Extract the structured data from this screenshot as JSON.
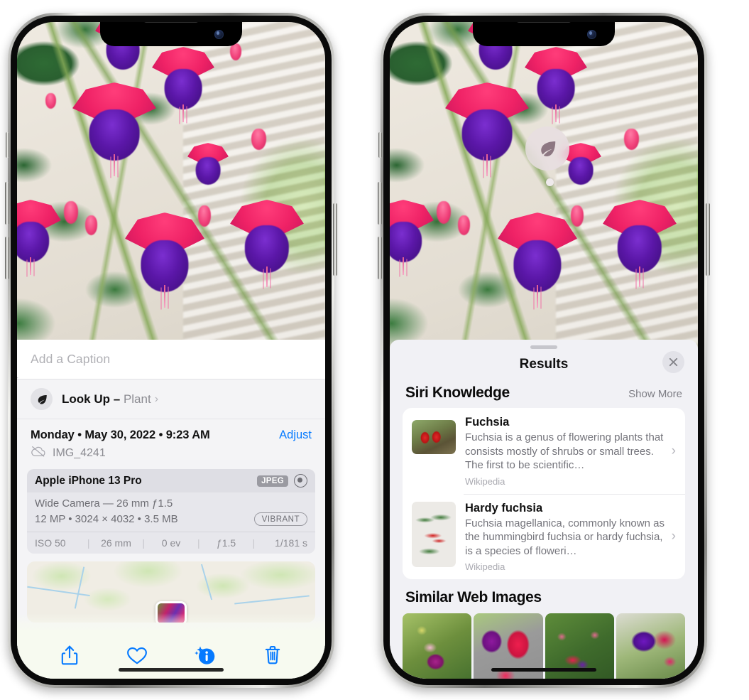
{
  "left_phone": {
    "name": "iphone-photos-info",
    "caption": {
      "placeholder": "Add a Caption",
      "value": ""
    },
    "lookup": {
      "icon": "leaf-icon",
      "sparkle_icon": "sparkle-icon",
      "label": "Look Up",
      "dash": "–",
      "subject": "Plant",
      "chevron": "›"
    },
    "meta": {
      "date": "Monday • May 30, 2022 • 9:23 AM",
      "adjust_label": "Adjust",
      "cloud_icon": "cloud-slash-icon",
      "filename": "IMG_4241"
    },
    "exif": {
      "device": "Apple iPhone 13 Pro",
      "format_tag": "JPEG",
      "aperture_icon": "aperture-icon",
      "lens": "Wide Camera — 26 mm ƒ1.5",
      "specs": "12 MP • 3024 × 4032 • 3.5 MB",
      "style_tag": "VIBRANT",
      "stats": [
        "ISO 50",
        "26 mm",
        "0 ev",
        "ƒ1.5",
        "1/181 s"
      ]
    },
    "map": {
      "name": "location-map",
      "pin": "photo-thumbnail-pin"
    },
    "toolbar": [
      {
        "name": "share-button",
        "icon": "share-icon"
      },
      {
        "name": "favorite-button",
        "icon": "heart-icon"
      },
      {
        "name": "info-button",
        "icon": "info-sparkle-icon"
      },
      {
        "name": "delete-button",
        "icon": "trash-icon"
      }
    ],
    "accent_color": "#067aff"
  },
  "right_phone": {
    "name": "visual-lookup-results",
    "badge": {
      "icon": "leaf-icon"
    },
    "sheet": {
      "title": "Results",
      "close_icon": "close-icon",
      "grabber": "drag-handle"
    },
    "siri_knowledge": {
      "title": "Siri Knowledge",
      "show_more": "Show More",
      "items": [
        {
          "title": "Fuchsia",
          "description": "Fuchsia is a genus of flowering plants that consists mostly of shrubs or small trees. The first to be scientific…",
          "source": "Wikipedia",
          "chevron": "›"
        },
        {
          "title": "Hardy fuchsia",
          "description": "Fuchsia magellanica, commonly known as the hummingbird fuchsia or hardy fuchsia, is a species of floweri…",
          "source": "Wikipedia",
          "chevron": "›"
        }
      ]
    },
    "similar_web_images": {
      "title": "Similar Web Images",
      "count": 4
    }
  }
}
